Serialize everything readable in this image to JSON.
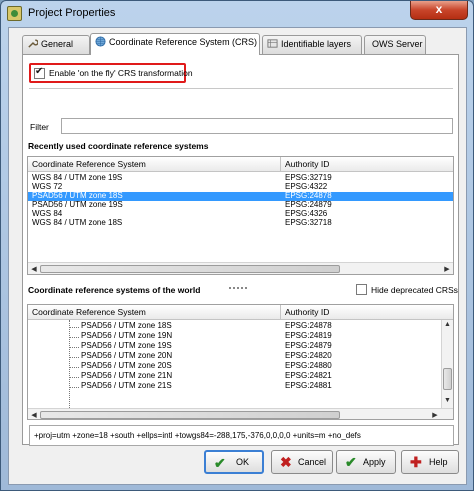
{
  "window": {
    "title": "Project Properties",
    "close_glyph": "x"
  },
  "tabs": [
    {
      "label": "General",
      "icon": "wrench-icon"
    },
    {
      "label": "Coordinate Reference System (CRS)",
      "icon": "globe-icon"
    },
    {
      "label": "Identifiable layers",
      "icon": "layers-icon"
    },
    {
      "label": "OWS Server",
      "icon": ""
    }
  ],
  "crs_tab": {
    "otf_checkbox": {
      "label": "Enable 'on the fly' CRS transformation",
      "checked": true
    },
    "filter": {
      "label": "Filter",
      "value": ""
    },
    "recent": {
      "heading": "Recently used coordinate reference systems",
      "columns": [
        "Coordinate Reference System",
        "Authority ID"
      ],
      "rows": [
        [
          "WGS 84 / UTM zone 19S",
          "EPSG:32719"
        ],
        [
          "WGS 72",
          "EPSG:4322"
        ],
        [
          "PSAD56 / UTM zone 18S",
          "EPSG:24878"
        ],
        [
          "PSAD56 / UTM zone 19S",
          "EPSG:24879"
        ],
        [
          "WGS 84",
          "EPSG:4326"
        ],
        [
          "WGS 84 / UTM zone 18S",
          "EPSG:32718"
        ]
      ],
      "selected_index": 2
    },
    "world": {
      "heading": "Coordinate reference systems of the world",
      "hide_deprecated": {
        "label": "Hide deprecated CRSs",
        "checked": false
      },
      "columns": [
        "Coordinate Reference System",
        "Authority ID"
      ],
      "rows": [
        [
          "PSAD56 / UTM zone 18S",
          "EPSG:24878"
        ],
        [
          "PSAD56 / UTM zone 19N",
          "EPSG:24819"
        ],
        [
          "PSAD56 / UTM zone 19S",
          "EPSG:24879"
        ],
        [
          "PSAD56 / UTM zone 20N",
          "EPSG:24820"
        ],
        [
          "PSAD56 / UTM zone 20S",
          "EPSG:24880"
        ],
        [
          "PSAD56 / UTM zone 21N",
          "EPSG:24821"
        ],
        [
          "PSAD56 / UTM zone 21S",
          "EPSG:24881"
        ]
      ]
    },
    "proj_string": "+proj=utm +zone=18 +south +ellps=intl +towgs84=-288,175,-376,0,0,0,0 +units=m +no_defs"
  },
  "buttons": {
    "ok": {
      "label": "OK",
      "icon": "check-icon"
    },
    "cancel": {
      "label": "Cancel",
      "icon": "cross-icon"
    },
    "apply": {
      "label": "Apply",
      "icon": "check-icon"
    },
    "help": {
      "label": "Help",
      "icon": "help-icon"
    }
  },
  "colors": {
    "selection": "#3399ff",
    "highlight_frame": "#e01a1a",
    "ok_glyph": "#2a8a2a",
    "cancel_glyph": "#c02020"
  }
}
